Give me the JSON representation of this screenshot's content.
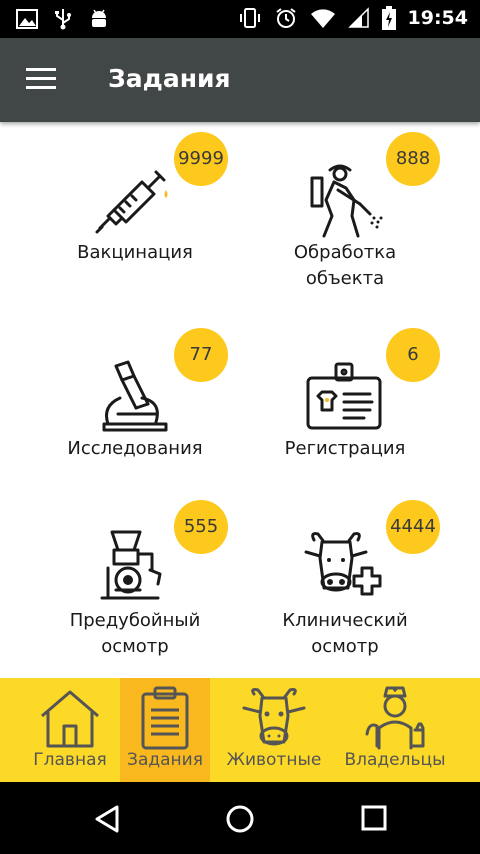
{
  "status": {
    "time": "19:54"
  },
  "header": {
    "title": "Задания"
  },
  "tiles": [
    {
      "label": "Вакцинация",
      "badge": "9999"
    },
    {
      "label": "Обработка\nобъекта",
      "label1": "Обработка",
      "label2": "объекта",
      "badge": "888"
    },
    {
      "label": "Исследования",
      "badge": "77"
    },
    {
      "label": "Регистрация",
      "badge": "6"
    },
    {
      "label1": "Предубойный",
      "label2": "осмотр",
      "badge": "555"
    },
    {
      "label1": "Клинический",
      "label2": "осмотр",
      "badge": "4444"
    }
  ],
  "bottom_nav": [
    {
      "label": "Главная",
      "icon": "house-icon"
    },
    {
      "label": "Задания",
      "icon": "clipboard-icon",
      "active": true
    },
    {
      "label": "Животные",
      "icon": "cow-icon"
    },
    {
      "label": "Владельцы",
      "icon": "veterinarian-icon"
    }
  ],
  "colors": {
    "appbar": "#414646",
    "accent": "#fcc91c",
    "nav": "#fcd827",
    "nav_active": "#f8b81e"
  }
}
